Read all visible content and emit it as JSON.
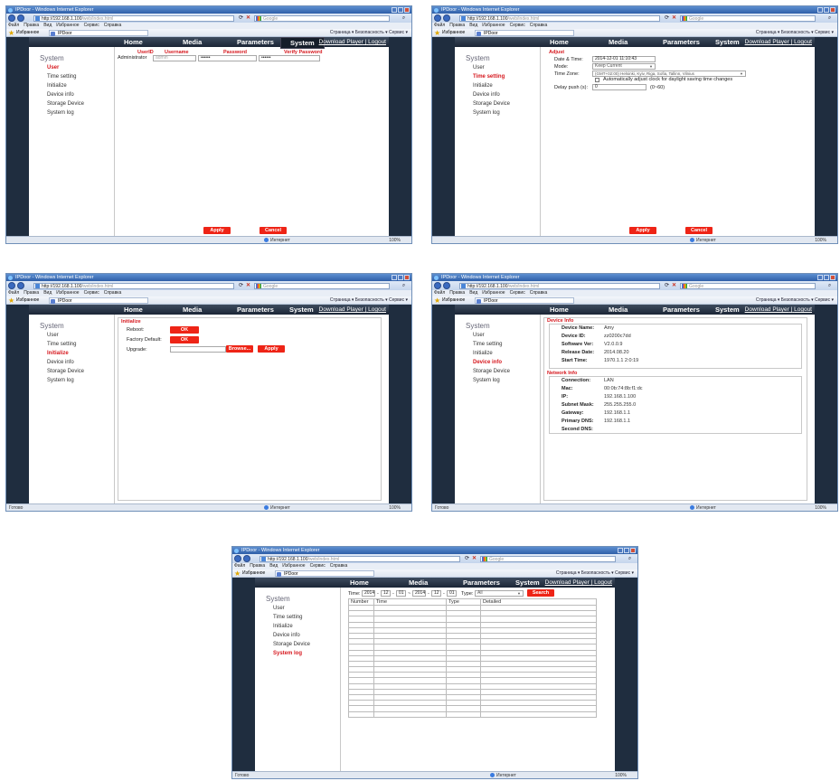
{
  "browser": {
    "title": "IPDoor - Windows Internet Explorer",
    "url_host": "http://192.168.1.100",
    "url_path": "/web/index.html",
    "search_placeholder": "Google",
    "menu": [
      "Файл",
      "Правка",
      "Вид",
      "Избранное",
      "Сервис",
      "Справка"
    ],
    "favorites_label": "Избранное",
    "tab_title": "IPDoor",
    "command_bar": "Страница ▾  Безопасность ▾  Сервис ▾",
    "status_text": "Готово",
    "zone": "Интернет",
    "zoom": "100%"
  },
  "site": {
    "nav": [
      "Home",
      "Media",
      "Parameters",
      "System"
    ],
    "download": "Download Player",
    "separator": "|",
    "logout": "Logout",
    "sidebar_title": "System",
    "sidebar_items": [
      "User",
      "Time setting",
      "Initialize",
      "Device info",
      "Storage Device",
      "System log"
    ],
    "apply": "Apply",
    "cancel": "Cancel"
  },
  "user_page": {
    "headers": [
      "UserID",
      "Username",
      "Password",
      "Verify Password"
    ],
    "user_id": "Administrator",
    "username_placeholder": "admin",
    "password": "••••••",
    "verify_password": "••••••"
  },
  "time_page": {
    "section": "Adjust",
    "date_time_label": "Date & Time:",
    "date_time_value": "2014-12-01 11:10:43",
    "mode_label": "Mode:",
    "mode_value": "Keep Current",
    "timezone_label": "Time Zone:",
    "timezone_value": "(GMT+02:00) Helsinki, Kyiv, Riga, Sofia, Tallinn, Vilnius",
    "dst_label": "Automatically adjust clock for daylight saving time changes",
    "delay_label": "Delay push (s):",
    "delay_value": "0",
    "delay_range": "(0~60)"
  },
  "init_page": {
    "section": "Initialize",
    "reboot_label": "Reboot:",
    "factory_label": "Factory Default:",
    "upgrade_label": "Upgrade:",
    "ok": "OK",
    "browse": "Browse...",
    "apply": "Apply"
  },
  "device_page": {
    "device_section": "Device Info",
    "device_rows": [
      {
        "label": "Device Name:",
        "value": "Amy"
      },
      {
        "label": "Device ID:",
        "value": "zz0200c7dd"
      },
      {
        "label": "Software Ver:",
        "value": "V2.0.0.9"
      },
      {
        "label": "Release Date:",
        "value": "2014.08.20"
      },
      {
        "label": "Start Time:",
        "value": "1970.1.1 2:0:19"
      }
    ],
    "network_section": "Network Info",
    "network_rows": [
      {
        "label": "Connection:",
        "value": "LAN"
      },
      {
        "label": "Mac:",
        "value": "00:0b:74:8b:f1:dc"
      },
      {
        "label": "IP:",
        "value": "192.168.1.100"
      },
      {
        "label": "Subnet Mask:",
        "value": "255.255.255.0"
      },
      {
        "label": "Gateway:",
        "value": "192.168.1.1"
      },
      {
        "label": "Primary DNS:",
        "value": "192.168.1.1"
      },
      {
        "label": "Second DNS:",
        "value": ""
      }
    ]
  },
  "log_page": {
    "time_label": "Time:",
    "from_year": "2014",
    "from_month": "12",
    "from_day": "01",
    "to_year": "2014",
    "to_month": "12",
    "to_day": "01",
    "dash": "-",
    "tilde": "~",
    "type_label": "Type:",
    "type_value": "All",
    "search": "Search",
    "columns": [
      "Number",
      "Time",
      "Type",
      "Detailed"
    ]
  },
  "colors": {
    "accent": "#ee2416",
    "active_item": "#d6181e",
    "dark_bg": "#1f2d3f"
  }
}
